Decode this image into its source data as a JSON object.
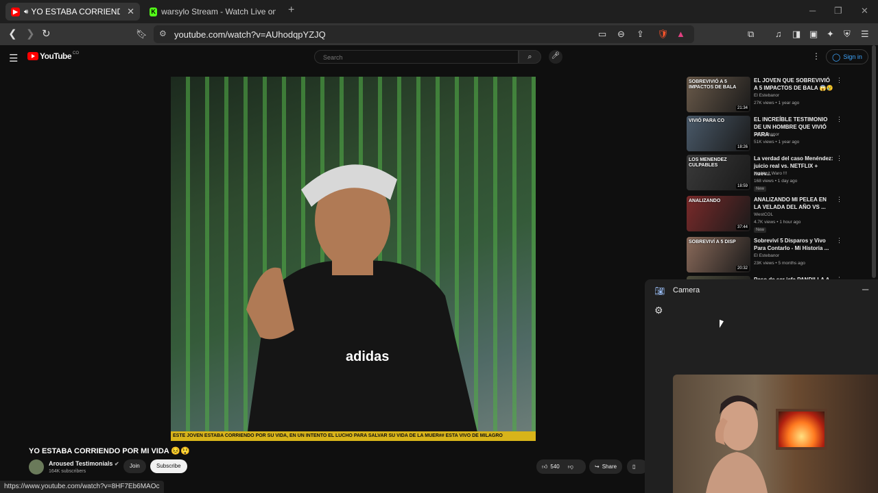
{
  "browser": {
    "tabs": [
      {
        "title": "YO ESTABA CORRIENDO POR",
        "favicon": "youtube-favicon",
        "active": true,
        "audio": "speaker-icon"
      },
      {
        "title": "warsylo Stream - Watch Live on Kick",
        "favicon": "kick-favicon",
        "active": false
      }
    ],
    "url": "youtube.com/watch?v=AUhodqpYZJQ",
    "status_url": "https://www.youtube.com/watch?v=8HF7Eb6MAOc"
  },
  "youtube": {
    "logo_text": "YouTube",
    "country_code": "CO",
    "search_placeholder": "Search",
    "signin_label": "Sign in"
  },
  "video": {
    "caption": "ESTE JOVEN ESTABA CORRIENDO POR SU VIDA, EN UN INTENTO EL LUCHO PARA SALVAR SU VIDA DE LA MUER## ESTA VIVO DE MILAGRO",
    "title": "YO ESTABA CORRIENDO POR MI VIDA 😣😲",
    "channel": "Aroused Testimonials",
    "subscribers": "164K subscribers",
    "join_label": "Join",
    "subscribe_label": "Subscribe",
    "likes": "540",
    "share_label": "Share"
  },
  "sidebar": [
    {
      "title": "EL JOVEN QUE SOBREVIVIÓ A 5 IMPACTOS DE BALA 😱😢",
      "channel": "El Estebanor",
      "meta": "27K views • 1 year ago",
      "duration": "21:34",
      "overlay": "SOBREVIVIÓ A 5 IMPACTOS DE BALA",
      "badge": "",
      "color": "#6a5a4a"
    },
    {
      "title": "EL INCREÍBLE TESTIMONIO DE UN HOMBRE QUE VIVIÓ PARA ...",
      "channel": "El Estebanor",
      "meta": "51K views • 1 year ago",
      "duration": "18:26",
      "overlay": "VIVIÓ PARA CO",
      "badge": "",
      "color": "#4a5a6a"
    },
    {
      "title": "La verdad del caso Menéndez: juicio real vs. NETFLIX + nuev...",
      "channel": "No Limit Waro !!!",
      "meta": "168 views • 1 day ago",
      "duration": "18:59",
      "overlay": "LOS MENENDEZ CULPABLES",
      "badge": "New",
      "color": "#3a3a3a"
    },
    {
      "title": "ANALIZANDO MI PELEA EN LA VELADA DEL AÑO VS ...",
      "channel": "WestCOL",
      "meta": "4.7K views • 1 hour ago",
      "duration": "37:44",
      "overlay": "ANALIZANDO",
      "badge": "New",
      "color": "#7a2a2a"
    },
    {
      "title": "Sobreviví 5 Disparos y Vivo Para Contarlo - Mi Historia ...",
      "channel": "El Estebanor",
      "meta": "23K views • 5 months ago",
      "duration": "20:32",
      "overlay": "SOBREVIVÍ A 5 DISP",
      "badge": "",
      "color": "#8a6a5a"
    },
    {
      "title": "Paso de ser jefa PANDILLA A...",
      "channel": "",
      "meta": "",
      "duration": "",
      "overlay": "",
      "badge": "",
      "color": "#4a4a3a"
    }
  ],
  "camera": {
    "title": "Camera"
  }
}
